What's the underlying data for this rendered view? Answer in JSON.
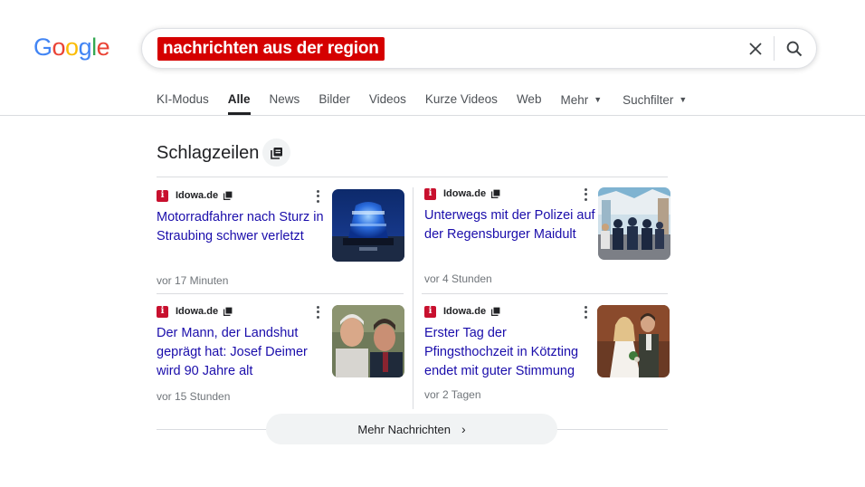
{
  "logo": {
    "letters": [
      "G",
      "o",
      "o",
      "g",
      "l",
      "e"
    ],
    "colors": [
      "#4285F4",
      "#EA4335",
      "#FBBC05",
      "#4285F4",
      "#34A853",
      "#EA4335"
    ]
  },
  "search": {
    "query": "nachrichten aus der region",
    "query_highlight": "#d50000"
  },
  "icons": {
    "clear": "close-icon",
    "search": "search-icon",
    "stack": "stack-icon",
    "more": "more-vert-icon",
    "chevron": "chevron-right-icon"
  },
  "tabs": [
    {
      "label": "KI-Modus"
    },
    {
      "label": "Alle",
      "active": true
    },
    {
      "label": "News"
    },
    {
      "label": "Bilder"
    },
    {
      "label": "Videos"
    },
    {
      "label": "Kurze Videos"
    },
    {
      "label": "Web"
    },
    {
      "label": "Mehr",
      "dropdown": true
    },
    {
      "label": "Suchfilter",
      "dropdown": true
    }
  ],
  "headlines": {
    "title": "Schlagzeilen",
    "articles": [
      {
        "source": "Idowa.de",
        "favicon": "i",
        "title": "Motorradfahrer nach Sturz in Straubing schwer verletzt",
        "time": "vor 17 Minuten"
      },
      {
        "source": "Idowa.de",
        "favicon": "i",
        "title": "Unterwegs mit der Polizei auf der Regensburger Maidult",
        "time": "vor 4 Stunden"
      },
      {
        "source": "Idowa.de",
        "favicon": "i",
        "title": "Der Mann, der Landshut geprägt hat: Josef Deimer wird 90 Jahre alt",
        "time": "vor 15 Stunden"
      },
      {
        "source": "Idowa.de",
        "favicon": "i",
        "title": "Erster Tag der Pfingsthochzeit in Kötzting endet mit guter Stimmung",
        "time": "vor 2 Tagen"
      }
    ]
  },
  "footer": {
    "more_label": "Mehr Nachrichten"
  }
}
